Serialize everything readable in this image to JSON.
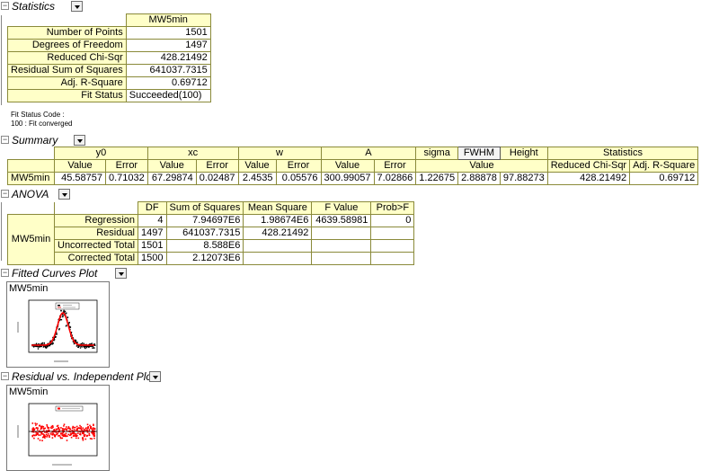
{
  "statistics": {
    "title": "Statistics",
    "column": "MW5min",
    "rows": [
      {
        "label": "Number of Points",
        "value": "1501"
      },
      {
        "label": "Degrees of Freedom",
        "value": "1497"
      },
      {
        "label": "Reduced Chi-Sqr",
        "value": "428.21492"
      },
      {
        "label": "Residual Sum of Squares",
        "value": "641037.7315"
      },
      {
        "label": "Adj. R-Square",
        "value": "0.69712"
      },
      {
        "label": "Fit Status",
        "value": "Succeeded(100)"
      }
    ],
    "note_line1": "Fit Status Code :",
    "note_line2": "100 : Fit converged"
  },
  "summary": {
    "title": "Summary",
    "groups": [
      "y0",
      "xc",
      "w",
      "A",
      "sigma",
      "FWHM",
      "Height",
      "Statistics"
    ],
    "subheaders": [
      "Value",
      "Error",
      "Value",
      "Error",
      "Value",
      "Error",
      "Value",
      "Error",
      "Value",
      "Reduced Chi-Sqr",
      "Adj. R-Square"
    ],
    "row_label": "MW5min",
    "values": [
      "45.58757",
      "0.71032",
      "67.29874",
      "0.02487",
      "2.4535",
      "0.05576",
      "300.99057",
      "7.02866",
      "1.22675",
      "2.88878",
      "97.88273",
      "428.21492",
      "0.69712"
    ]
  },
  "anova": {
    "title": "ANOVA",
    "headers": [
      "DF",
      "Sum of Squares",
      "Mean Square",
      "F Value",
      "Prob>F"
    ],
    "group_label": "MW5min",
    "rows": [
      {
        "label": "Regression",
        "df": "4",
        "ss": "7.94697E6",
        "ms": "1.98674E6",
        "f": "4639.58981",
        "p": "0"
      },
      {
        "label": "Residual",
        "df": "1497",
        "ss": "641037.7315",
        "ms": "428.21492",
        "f": "",
        "p": ""
      },
      {
        "label": "Uncorrected Total",
        "df": "1501",
        "ss": "8.588E6",
        "ms": "",
        "f": "",
        "p": ""
      },
      {
        "label": "Corrected Total",
        "df": "1500",
        "ss": "2.12073E6",
        "ms": "",
        "f": "",
        "p": ""
      }
    ]
  },
  "fitted_plot": {
    "title": "Fitted Curves Plot",
    "graph_label": "MW5min"
  },
  "residual_plot": {
    "title": "Residual vs. Independent Plo",
    "graph_label": "MW5min"
  },
  "colors": {
    "table_fill": "#ffffc8",
    "table_border": "#8a8a3a",
    "fit_curve": "#ff0000",
    "data_points": "#000000",
    "residual_points": "#ff0000"
  }
}
